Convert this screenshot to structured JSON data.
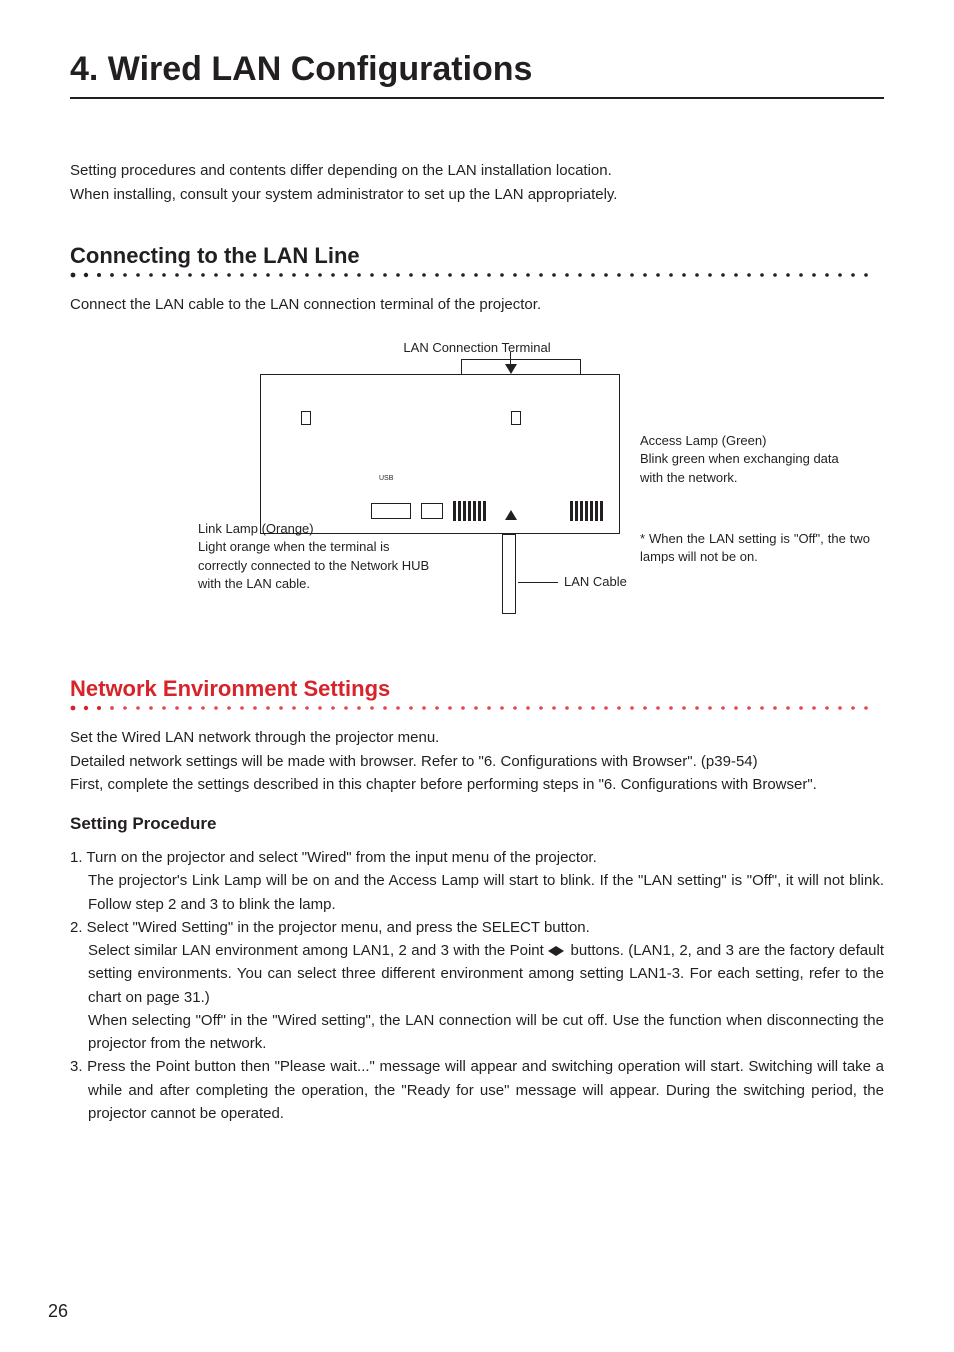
{
  "chapter": {
    "title": "4. Wired LAN Configurations"
  },
  "intro": {
    "p1": "Setting procedures and contents differ depending on the LAN installation location.",
    "p2": "When installing, consult your system administrator to set up the LAN appropriately."
  },
  "section1": {
    "title": "Connecting to the LAN Line",
    "p1": "Connect the LAN cable to the LAN connection terminal of the projector."
  },
  "diagram": {
    "caption": "LAN Connection Terminal",
    "usb": "USB",
    "link_title": "Link Lamp (Orange)",
    "link_body": "Light orange when the terminal is correctly connected to the Network HUB with the LAN cable.",
    "access_title": "Access Lamp (Green)",
    "access_body": "Blink green when exchanging data with the network.",
    "note": "* When the LAN setting is \"Off\", the two lamps will not be on.",
    "cable": "LAN Cable"
  },
  "section2": {
    "title": "Network Environment Settings",
    "p1": "Set the Wired LAN network through the projector menu.",
    "p2": "Detailed network settings will be made with browser.  Refer to \"6. Configurations with Browser\".  (p39-54)",
    "p3": "First, complete the settings described in this chapter before performing steps in \"6. Configurations with Browser\"."
  },
  "procedure": {
    "heading": "Setting Procedure",
    "s1a": "1. Turn on the projector and select \"Wired\" from the input menu of the projector.",
    "s1b": "The projector's Link Lamp will be on and the Access Lamp will start to blink.  If the \"LAN setting\" is \"Off\", it will not blink.  Follow step 2 and 3 to blink the lamp.",
    "s2a": "2. Select \"Wired Setting\" in the projector menu, and press the SELECT button.",
    "s2b_pre": "Select similar LAN environment among LAN1, 2 and 3 with the Point ",
    "s2b_post": " buttons.  (LAN1, 2, and 3 are the factory default setting environments.  You can select three different environment among setting LAN1-3.  For each setting, refer to the chart on page 31.)",
    "s2c": "When selecting \"Off\" in the \"Wired setting\", the LAN connection will be cut off.  Use the function when disconnecting the projector from the network.",
    "s3": "3. Press the Point button then \"Please wait...\" message will appear and switching operation will start.  Switching will take a while and after completing the operation, the \"Ready for use\" message will appear.  During the switching period, the projector cannot be operated."
  },
  "page": "26"
}
